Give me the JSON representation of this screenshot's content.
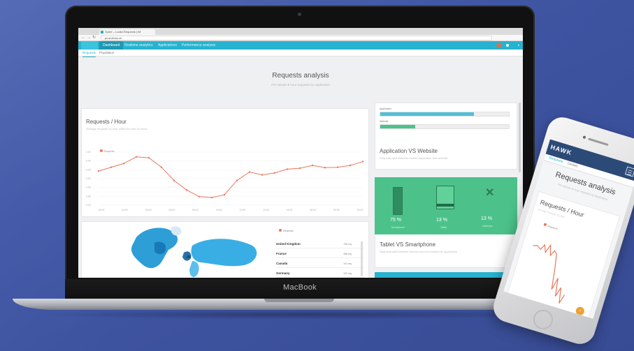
{
  "browser": {
    "tab_title": "Tyzler – Looks Requests | IM",
    "url": "prod.demo.ch"
  },
  "app": {
    "nav_items": [
      "Dashboard",
      "Realtime analytics",
      "Applications",
      "Performance analysis"
    ],
    "active_nav": "Dashboard",
    "subtabs": [
      "Requests",
      "Population"
    ],
    "page_title": "Requests analysis",
    "page_subtitle": "Per minute & hour requests by Application"
  },
  "requests_card": {
    "title": "Requests / Hour",
    "subtitle": "Average requests by hour within the last 24 hours",
    "legend": "Requests"
  },
  "chart_data": {
    "type": "line",
    "title": "Requests / Hour",
    "series": [
      {
        "name": "Requests",
        "color": "#e8775c",
        "values": [
          380,
          400,
          420,
          455,
          450,
          400,
          330,
          280,
          245,
          240,
          255,
          330,
          375,
          360,
          370,
          390,
          395,
          410,
          398,
          400,
          410,
          430
        ]
      }
    ],
    "y_ticks": [
      "0.00",
      "0.00",
      "0.00",
      "0.00",
      "0.00",
      "0.00",
      "0.00"
    ],
    "x_ticks": [
      "00:00",
      "02:00",
      "04:00",
      "06:00",
      "08:00",
      "10:00",
      "12:00",
      "14:00",
      "16:00",
      "18:00",
      "20:00",
      "22:00"
    ],
    "ylim": [
      200,
      480
    ]
  },
  "app_vs_web": {
    "title": "Application VS Website",
    "subtitle": "Requests split between mobile application and website",
    "bars": [
      {
        "label": "Application",
        "value": 0.73,
        "color": "#4ec1d8",
        "value_label": ""
      },
      {
        "label": "Website",
        "value": 0.27,
        "color": "#4cc28a",
        "value_label": "27%"
      }
    ]
  },
  "devices": {
    "items": [
      {
        "name": "Smartphone",
        "percent": "75 %",
        "icon": "smartphone-icon"
      },
      {
        "name": "Tablet",
        "percent": "13 %",
        "icon": "tablet-icon"
      },
      {
        "name": "Unknown",
        "percent": "13 %",
        "icon": "close-icon"
      }
    ]
  },
  "tablet_vs_smartphone": {
    "title": "Tablet VS Smartphone",
    "subtitle": "Requests split between devices used to browse the application"
  },
  "countries": {
    "legend": "Requests",
    "rows": [
      {
        "name": "United Kingdom",
        "value": "738 req"
      },
      {
        "name": "France",
        "value": "468 req"
      },
      {
        "name": "Canada",
        "value": "141 req"
      },
      {
        "name": "Germany",
        "value": "129 req"
      }
    ]
  },
  "laptop_brand": "MacBook",
  "phone": {
    "logo": "HAWK",
    "tabs": [
      "Requests",
      "Details"
    ],
    "title": "Requests analysis",
    "subtitle": "Per minute & hour requests by Application",
    "card_title": "Requests / Hour",
    "card_subtitle": "Average requests by hour",
    "legend": "Requests"
  }
}
